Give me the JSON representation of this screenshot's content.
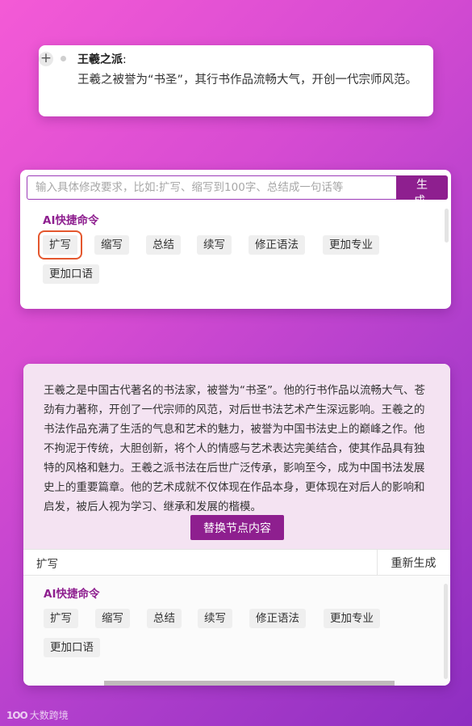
{
  "node": {
    "add_icon": "plus-icon",
    "title": "王羲之派",
    "colon": ":",
    "body": "王羲之被誉为“书圣”，其行书作品流畅大气，开创一代宗师风范。"
  },
  "prompt": {
    "placeholder": "输入具体修改要求，比如:扩写、缩写到100字、总结成一句话等",
    "generate_label": "生 成",
    "shortcuts_label": "AI快捷命令",
    "chips": [
      "扩写",
      "缩写",
      "总结",
      "续写",
      "修正语法",
      "更加专业",
      "更加口语"
    ],
    "selected_chip": "扩写"
  },
  "result": {
    "text": "王羲之是中国古代著名的书法家，被誉为“书圣”。他的行书作品以流畅大气、苍劲有力著称，开创了一代宗师的风范，对后世书法艺术产生深远影响。王羲之的书法作品充满了生活的气息和艺术的魅力，被誉为中国书法史上的巅峰之作。他不拘泥于传统，大胆创新，将个人的情感与艺术表达完美结合，使其作品具有独特的风格和魅力。王羲之派书法在后世广泛传承，影响至今，成为中国书法发展史上的重要篇章。他的艺术成就不仅体现在作品本身，更体现在对后人的影响和启发，被后人视为学习、继承和发展的楷模。",
    "replace_label": "替换节点内容",
    "command_value": "扩写",
    "regenerate_label": "重新生成",
    "shortcuts_label": "AI快捷命令",
    "chips": [
      "扩写",
      "缩写",
      "总结",
      "续写",
      "修正语法",
      "更加专业",
      "更加口语"
    ]
  },
  "watermark": {
    "logo": "1OO",
    "text": "大数跨境"
  },
  "colors": {
    "accent": "#8e1f8f",
    "highlight_outline": "#e4572e",
    "result_bg": "#f4e3f2"
  }
}
